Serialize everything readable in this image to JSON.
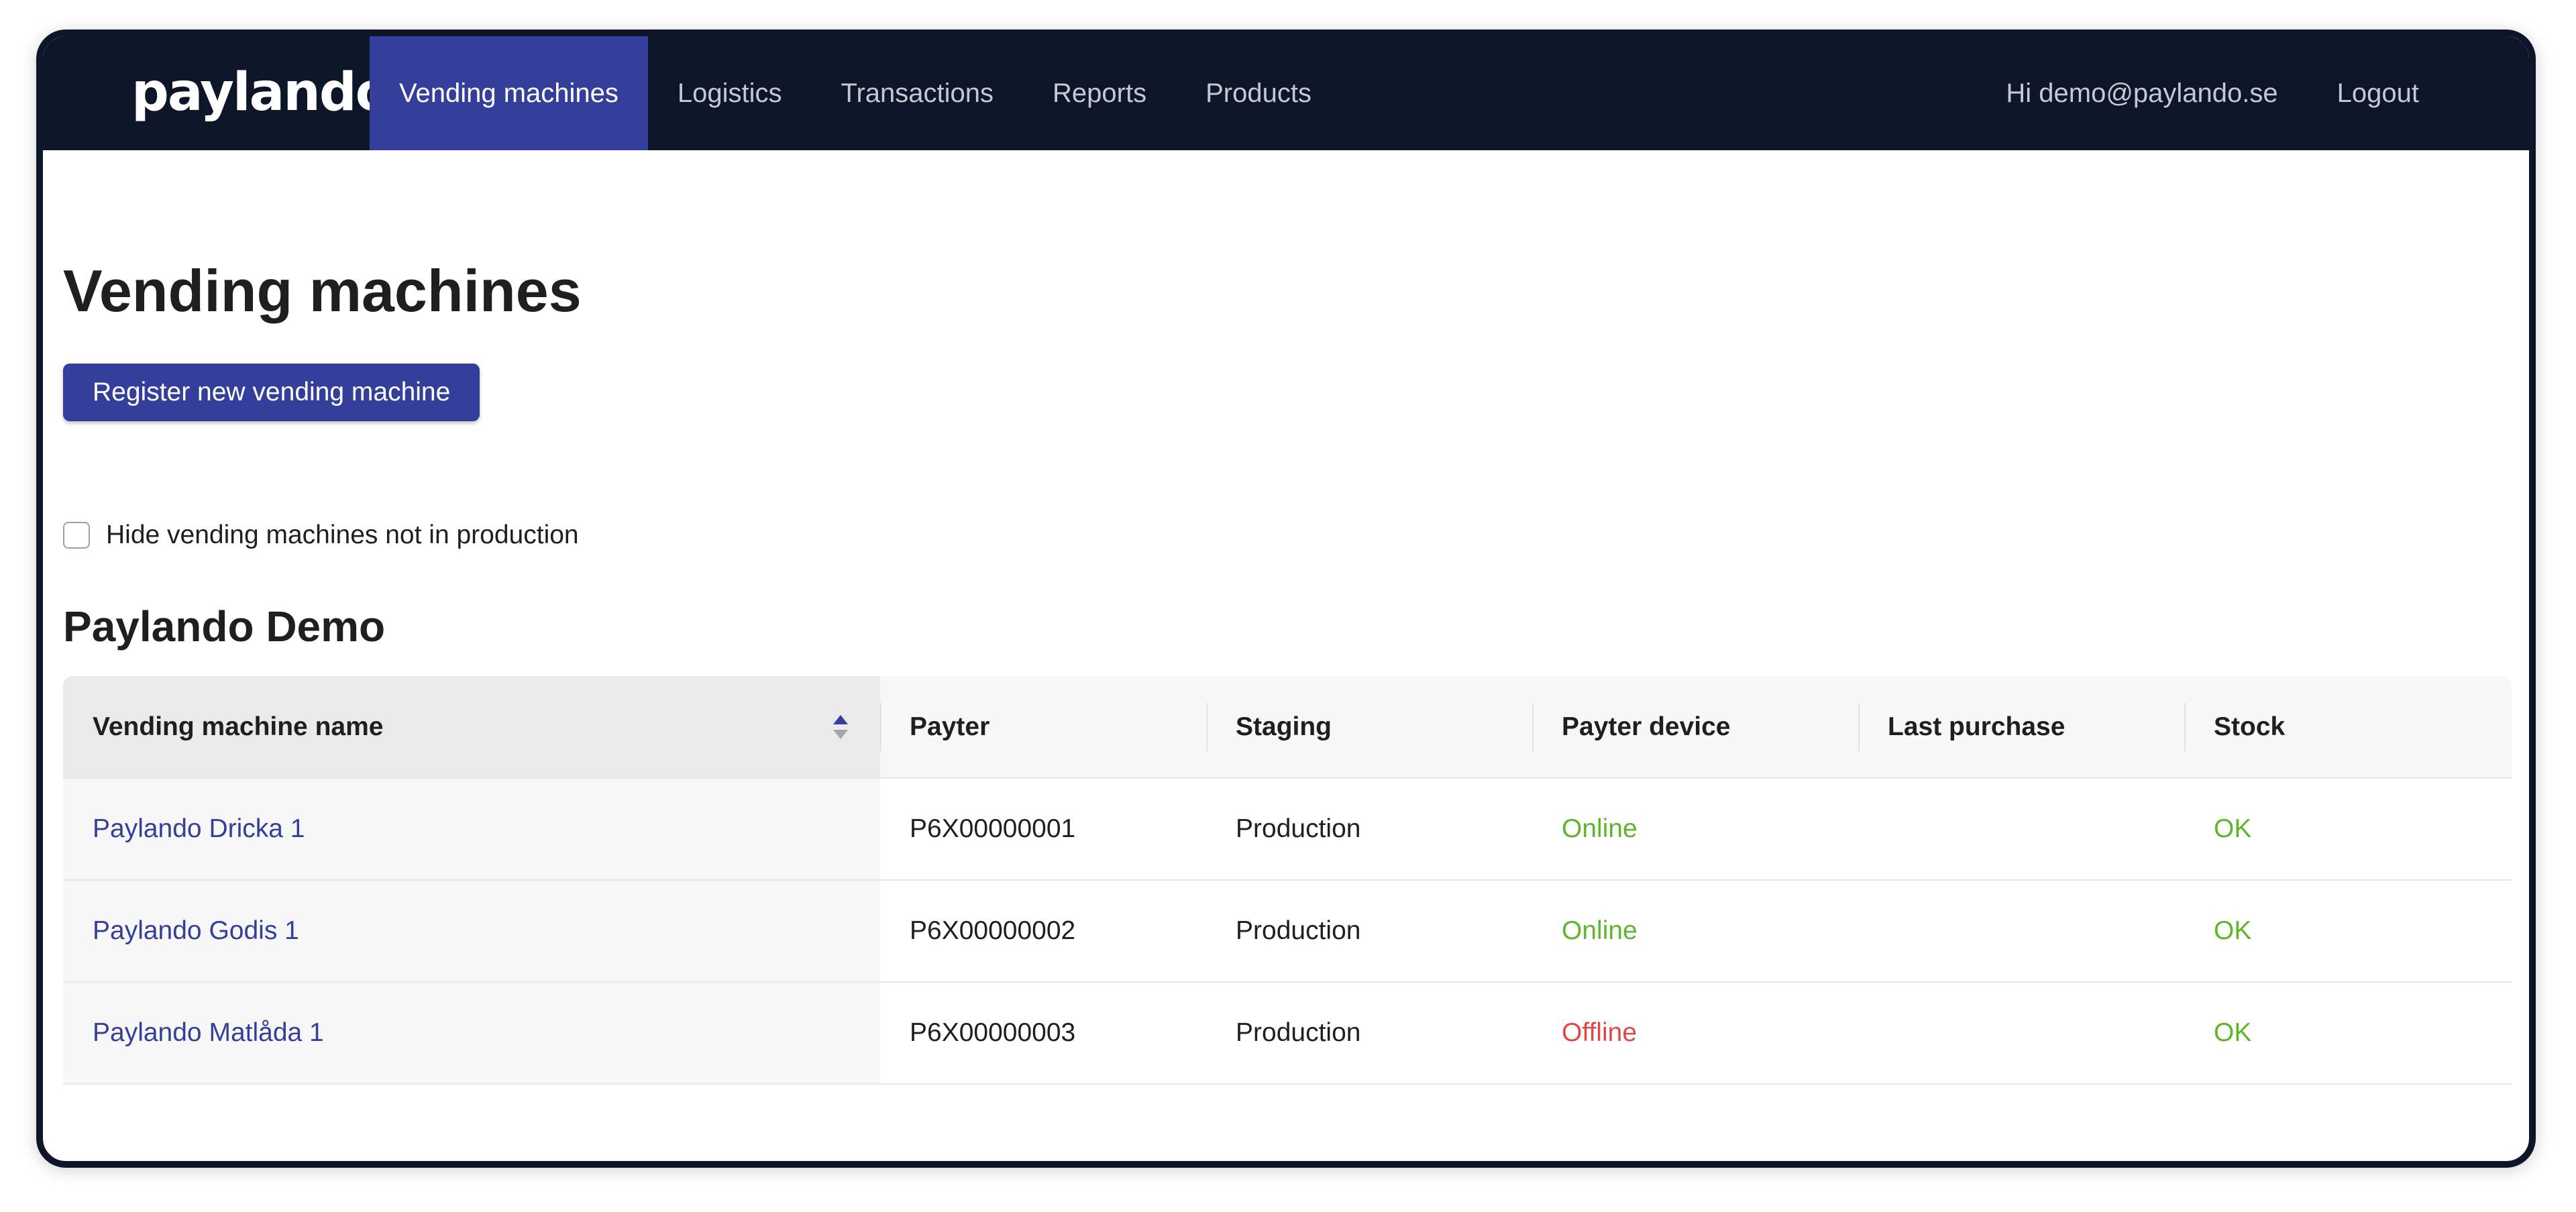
{
  "app": {
    "logo_text": "paylando"
  },
  "nav": {
    "items": [
      {
        "label": "Vending machines",
        "active": true
      },
      {
        "label": "Logistics",
        "active": false
      },
      {
        "label": "Transactions",
        "active": false
      },
      {
        "label": "Reports",
        "active": false
      },
      {
        "label": "Products",
        "active": false
      }
    ],
    "greeting": "Hi demo@paylando.se",
    "logout_label": "Logout"
  },
  "page": {
    "title": "Vending machines",
    "register_button_label": "Register new vending machine",
    "hide_filter_label": "Hide vending machines not in production",
    "hide_filter_checked": false
  },
  "group": {
    "title": "Paylando Demo",
    "columns": [
      "Vending machine name",
      "Payter",
      "Staging",
      "Payter device",
      "Last purchase",
      "Stock"
    ],
    "sort_icon": "sort-up-down-icon",
    "rows": [
      {
        "name": "Paylando Dricka 1",
        "payter": "P6X00000001",
        "staging": "Production",
        "payter_device": "Online",
        "last_purchase": "",
        "stock": "OK"
      },
      {
        "name": "Paylando Godis 1",
        "payter": "P6X00000002",
        "staging": "Production",
        "payter_device": "Online",
        "last_purchase": "",
        "stock": "OK"
      },
      {
        "name": "Paylando Matlåda 1",
        "payter": "P6X00000003",
        "staging": "Production",
        "payter_device": "Offline",
        "last_purchase": "",
        "stock": "OK"
      }
    ]
  },
  "colors": {
    "navbar_bg": "#0d1629",
    "accent": "#333f9a",
    "online": "#5fb52b",
    "offline": "#e04848"
  }
}
